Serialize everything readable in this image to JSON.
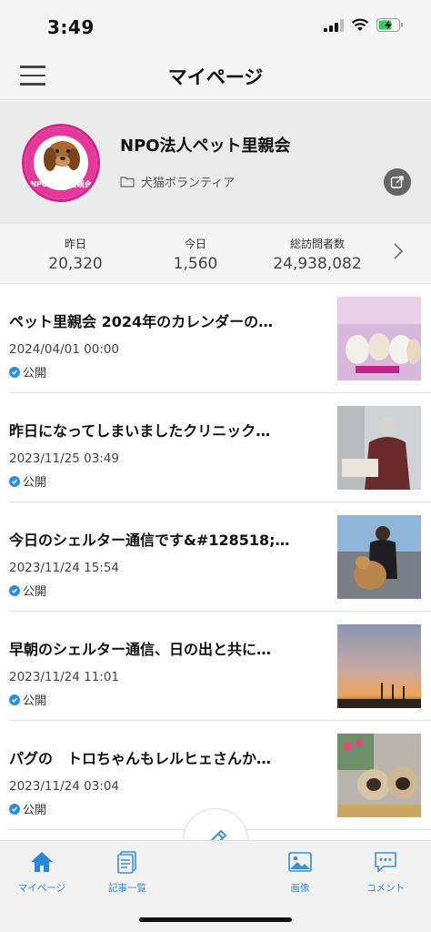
{
  "status_bar": {
    "time": "3:49"
  },
  "header": {
    "title": "マイページ"
  },
  "profile": {
    "name": "NPO法人ペット里親会",
    "category": "犬猫ボランティア",
    "logo_text": "NPOペット里親会"
  },
  "stats": [
    {
      "label": "昨日",
      "value": "20,320"
    },
    {
      "label": "今日",
      "value": "1,560"
    },
    {
      "label": "総訪問者数",
      "value": "24,938,082"
    }
  ],
  "articles": [
    {
      "title": "ペット里親会 2024年のカレンダーの…",
      "date": "2024/04/01 00:00",
      "status": "公開"
    },
    {
      "title": "昨日になってしまいましたクリニック…",
      "date": "2023/11/25 03:49",
      "status": "公開"
    },
    {
      "title": "今日のシェルター通信です&#128518;…",
      "date": "2023/11/24 15:54",
      "status": "公開"
    },
    {
      "title": "早朝のシェルター通信、日の出と共に…",
      "date": "2023/11/24 11:01",
      "status": "公開"
    },
    {
      "title": "パグの　トロちゃんもレルヒェさんか…",
      "date": "2023/11/24 03:04",
      "status": "公開"
    }
  ],
  "bottom_nav": [
    {
      "label": "マイページ",
      "icon": "home-icon"
    },
    {
      "label": "記事一覧",
      "icon": "article-list-icon"
    },
    {
      "label": "画像",
      "icon": "image-icon"
    },
    {
      "label": "コメント",
      "icon": "comment-icon"
    }
  ],
  "colors": {
    "accent": "#2a86d8",
    "logo_magenta": "#d6208a"
  }
}
